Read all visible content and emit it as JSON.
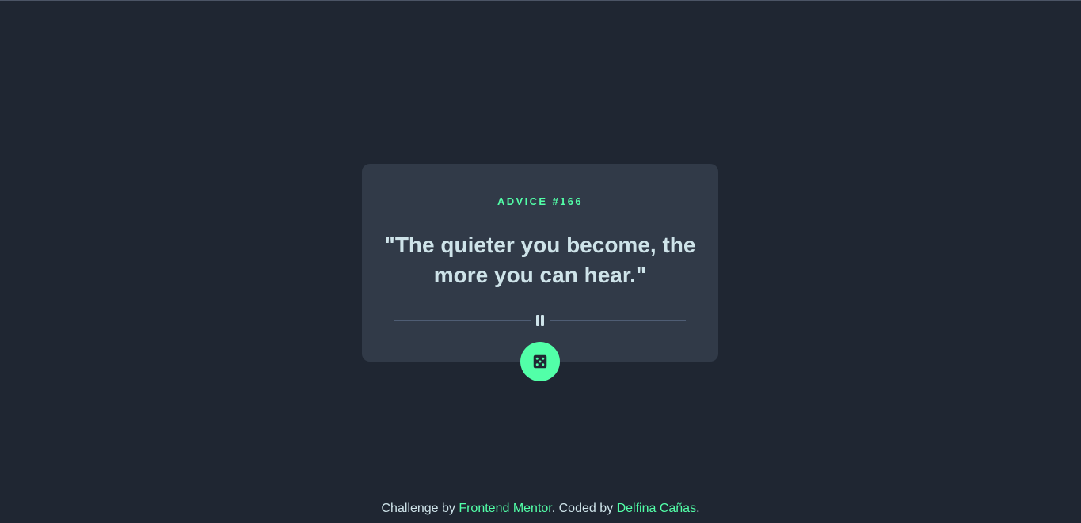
{
  "card": {
    "advice_id": "ADVICE #166",
    "advice_text": "\"The quieter you become, the more you can hear.\""
  },
  "divider": {
    "icon": "pause-icon"
  },
  "dice_button": {
    "icon": "dice-icon"
  },
  "attribution": {
    "prefix": "Challenge by ",
    "link1": "Frontend Mentor",
    "middle": ". Coded by ",
    "link2": "Delfina Cañas",
    "suffix": "."
  },
  "colors": {
    "background": "#1f2632",
    "card": "#313a48",
    "accent": "#52ffa8",
    "text": "#cee3e9",
    "divider": "#4f5d74"
  }
}
